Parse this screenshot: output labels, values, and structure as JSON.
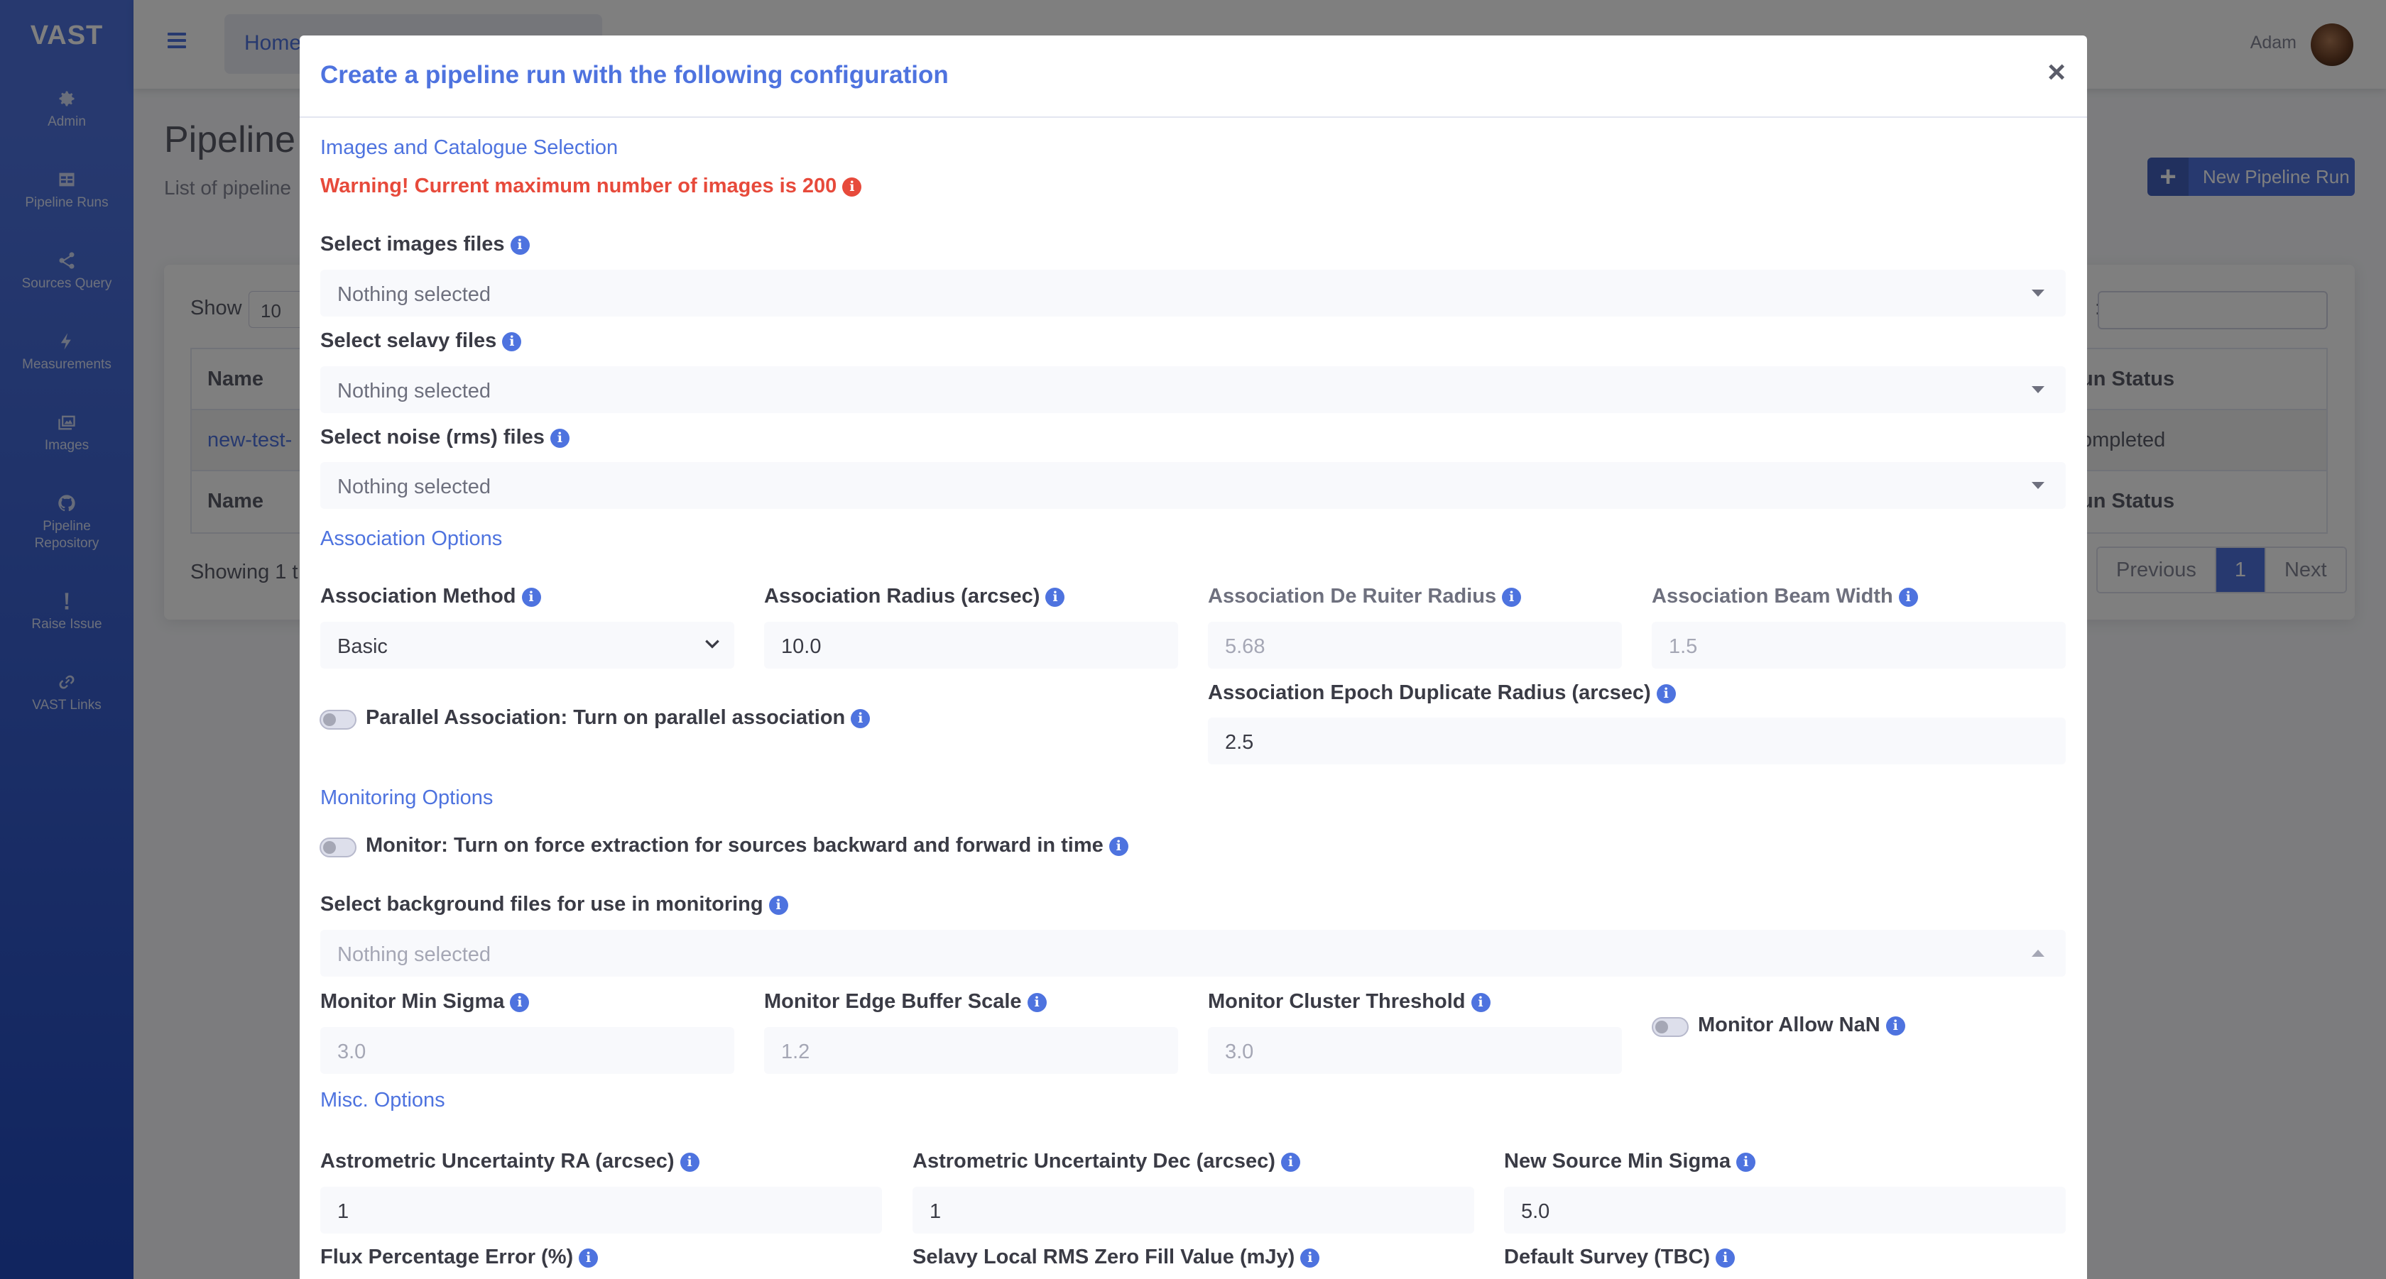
{
  "sidebar": {
    "brand": "VAST",
    "items": [
      {
        "label": "Admin",
        "icon": "gear-icon"
      },
      {
        "label": "Pipeline Runs",
        "icon": "table-icon"
      },
      {
        "label": "Sources Query",
        "icon": "share-icon"
      },
      {
        "label": "Measurements",
        "icon": "bolt-icon"
      },
      {
        "label": "Images",
        "icon": "images-icon"
      },
      {
        "label": "Pipeline Repository",
        "icon": "github-icon"
      },
      {
        "label": "Raise Issue",
        "icon": "exclamation-icon"
      },
      {
        "label": "VAST Links",
        "icon": "link-icon"
      }
    ]
  },
  "topbar": {
    "breadcrumb": "Home",
    "user": "Adam"
  },
  "page": {
    "title": "Pipeline",
    "subtitle": "List of pipeline",
    "new_run_button": "New Pipeline Run",
    "show_label": "Show",
    "show_value": "10",
    "search_label": ":",
    "table": {
      "header_left": "Name",
      "header_right": "un Status",
      "row_name": "new-test-",
      "row_status": "ompleted",
      "footer_left": "Name",
      "footer_right": "un Status"
    },
    "showing": "Showing 1 t",
    "pager": {
      "previous": "Previous",
      "current": "1",
      "next": "Next"
    }
  },
  "modal": {
    "title": "Create a pipeline run with the following configuration",
    "close": "×",
    "images_section": "Images and Catalogue Selection",
    "warning": "Warning! Current maximum number of images is 200",
    "image_files_label": "Select images files",
    "image_files_value": "Nothing selected",
    "selavy_files_label": "Select selavy files",
    "selavy_files_value": "Nothing selected",
    "noise_files_label": "Select noise (rms) files",
    "noise_files_value": "Nothing selected",
    "association_section": "Association Options",
    "assoc_method_label": "Association Method",
    "assoc_method_value": "Basic",
    "assoc_radius_label": "Association Radius (arcsec)",
    "assoc_radius_value": "10.0",
    "assoc_deruiter_label": "Association De Ruiter Radius",
    "assoc_deruiter_value": "5.68",
    "assoc_beam_label": "Association Beam Width",
    "assoc_beam_value": "1.5",
    "parallel_label": "Parallel Association: Turn on parallel association",
    "epoch_dup_label": "Association Epoch Duplicate Radius (arcsec)",
    "epoch_dup_value": "2.5",
    "monitoring_section": "Monitoring Options",
    "monitor_label": "Monitor: Turn on force extraction for sources backward and forward in time",
    "background_label": "Select background files for use in monitoring",
    "background_value": "Nothing selected",
    "min_sigma_label": "Monitor Min Sigma",
    "min_sigma_value": "3.0",
    "edge_buffer_label": "Monitor Edge Buffer Scale",
    "edge_buffer_value": "1.2",
    "cluster_threshold_label": "Monitor Cluster Threshold",
    "cluster_threshold_value": "3.0",
    "allow_nan_label": "Monitor Allow NaN",
    "misc_section": "Misc. Options",
    "astro_ra_label": "Astrometric Uncertainty RA (arcsec)",
    "astro_ra_value": "1",
    "astro_dec_label": "Astrometric Uncertainty Dec (arcsec)",
    "astro_dec_value": "1",
    "new_source_label": "New Source Min Sigma",
    "new_source_value": "5.0",
    "flux_pct_label": "Flux Percentage Error (%)",
    "selavy_rms_label": "Selavy Local RMS Zero Fill Value (mJy)",
    "default_survey_label": "Default Survey (TBC)"
  },
  "colors": {
    "primary": "#4e73df",
    "danger": "#e74a3b",
    "sidebar_end": "#224abe"
  }
}
